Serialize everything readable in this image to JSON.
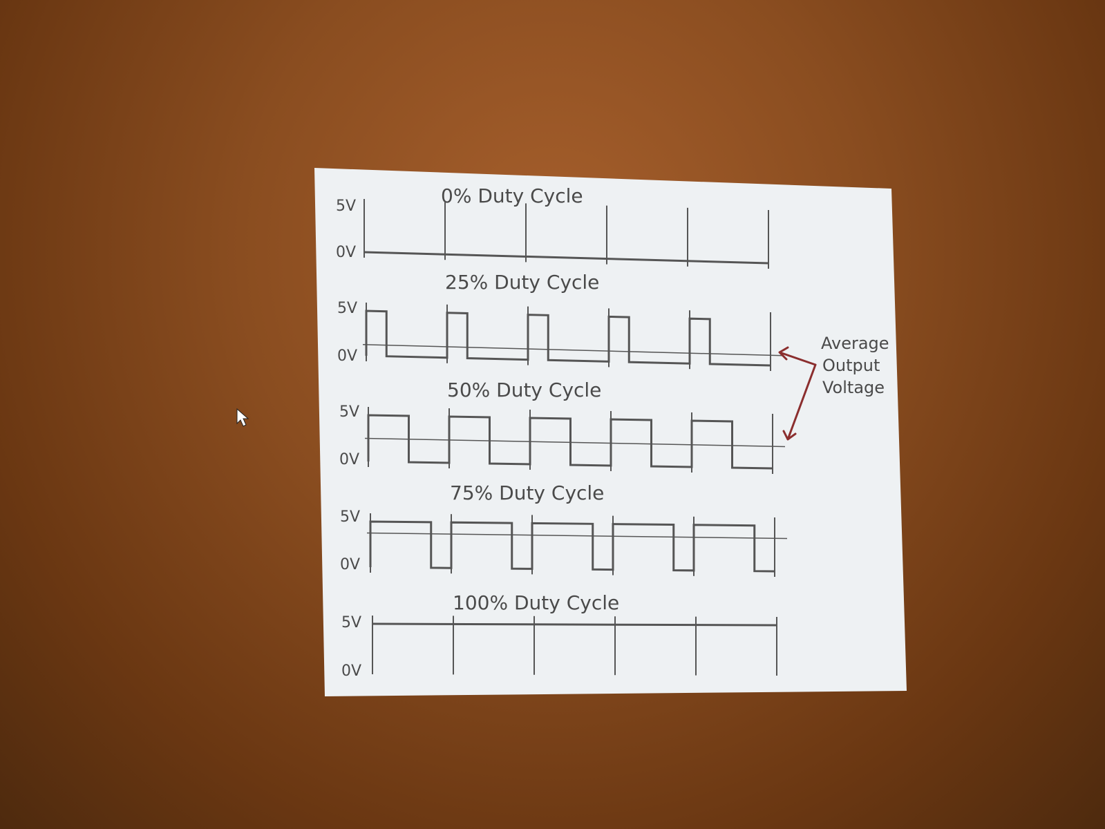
{
  "slide": {
    "panels": [
      {
        "title": "0% Duty Cycle",
        "duty": 0,
        "high_label": "5V",
        "low_label": "0V"
      },
      {
        "title": "25% Duty Cycle",
        "duty": 0.25,
        "high_label": "5V",
        "low_label": "0V"
      },
      {
        "title": "50% Duty Cycle",
        "duty": 0.5,
        "high_label": "5V",
        "low_label": "0V"
      },
      {
        "title": "75% Duty Cycle",
        "duty": 0.75,
        "high_label": "5V",
        "low_label": "0V"
      },
      {
        "title": "100% Duty Cycle",
        "duty": 1,
        "high_label": "5V",
        "low_label": "0V"
      }
    ],
    "annotation": [
      "Average",
      "Output",
      "Voltage"
    ],
    "periods": 5,
    "colors": {
      "wave": "#555555",
      "annotation": "#8b2e2e",
      "background": "#f2f4f5"
    }
  }
}
